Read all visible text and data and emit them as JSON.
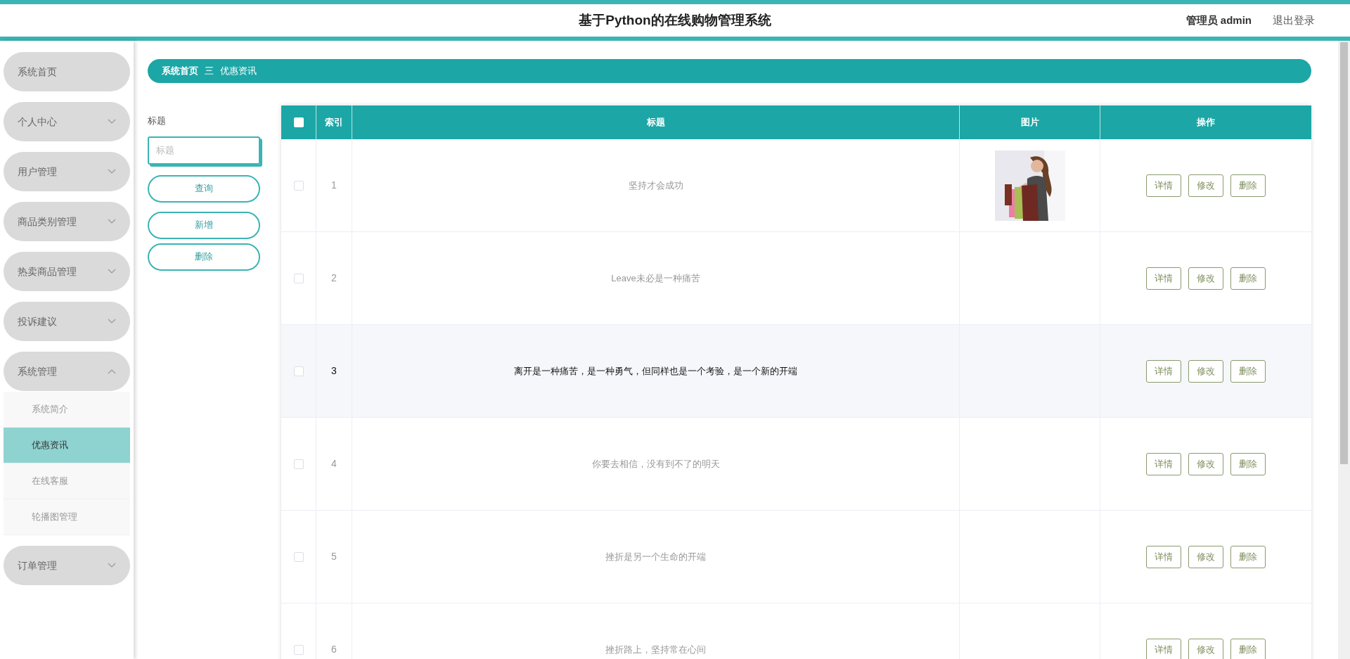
{
  "header": {
    "title": "基于Python的在线购物管理系统",
    "user": "管理员 admin",
    "logout": "退出登录"
  },
  "sidebar": {
    "items": [
      {
        "label": "系统首页",
        "kind": "link"
      },
      {
        "label": "个人中心",
        "kind": "menu",
        "expanded": false
      },
      {
        "label": "用户管理",
        "kind": "menu",
        "expanded": false
      },
      {
        "label": "商品类别管理",
        "kind": "menu",
        "expanded": false
      },
      {
        "label": "热卖商品管理",
        "kind": "menu",
        "expanded": false
      },
      {
        "label": "投诉建议",
        "kind": "menu",
        "expanded": false
      },
      {
        "label": "系统管理",
        "kind": "menu",
        "expanded": true,
        "children": [
          {
            "label": "系统简介",
            "selected": false
          },
          {
            "label": "优惠资讯",
            "selected": true
          },
          {
            "label": "在线客服",
            "selected": false
          },
          {
            "label": "轮播图管理",
            "selected": false
          }
        ]
      },
      {
        "label": "订单管理",
        "kind": "menu",
        "expanded": false
      }
    ]
  },
  "breadcrumb": {
    "items": [
      "系统首页",
      "优惠资讯"
    ],
    "separator": "三"
  },
  "filter": {
    "label": "标题",
    "placeholder": "标题",
    "buttons": [
      "查询",
      "新增",
      "删除"
    ]
  },
  "table": {
    "select_all_checked": false,
    "columns": [
      "索引",
      "标题",
      "图片",
      "操作"
    ],
    "rows": [
      {
        "checked": false,
        "highlighted": false,
        "index": "1",
        "title": "坚持才会成功",
        "image": {
          "kind": "picture"
        },
        "actions": [
          "详情",
          "修改",
          "删除"
        ]
      },
      {
        "checked": false,
        "highlighted": false,
        "index": "2",
        "title": "Leave未必是一种痛苦",
        "actions": [
          "详情",
          "修改",
          "删除"
        ]
      },
      {
        "checked": false,
        "highlighted": true,
        "index": "3",
        "title": "离开是一种痛苦，是一种勇气，但同样也是一个考验，是一个新的开端",
        "actions": [
          "详情",
          "修改",
          "删除"
        ]
      },
      {
        "checked": false,
        "highlighted": false,
        "index": "4",
        "title": "你要去相信，没有到不了的明天",
        "actions": [
          "详情",
          "修改",
          "删除"
        ]
      },
      {
        "checked": false,
        "highlighted": false,
        "index": "5",
        "title": "挫折是另一个生命的开端",
        "actions": [
          "详情",
          "修改",
          "删除"
        ]
      },
      {
        "checked": false,
        "highlighted": false,
        "index": "6",
        "title": "挫折路上，坚持常在心间",
        "actions": [
          "详情",
          "修改",
          "删除"
        ]
      }
    ]
  }
}
